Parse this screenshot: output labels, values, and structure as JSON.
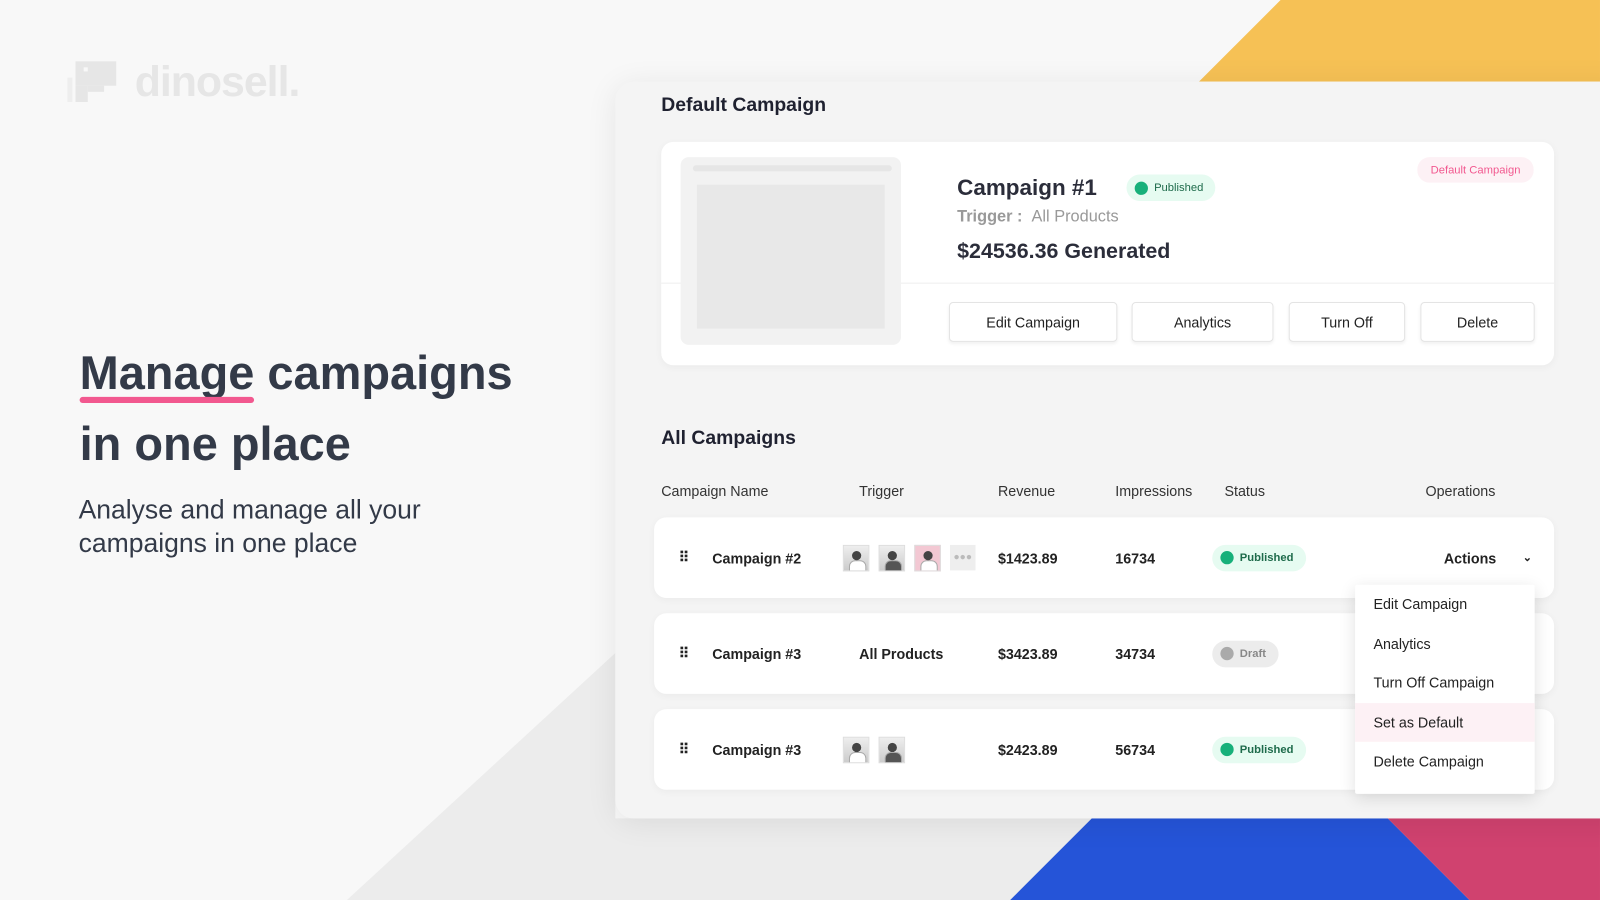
{
  "brand": {
    "name": "dinosell."
  },
  "hero": {
    "title_underlined": "Manage",
    "title_rest": " campaigns",
    "title_line2": "in one place",
    "subtitle": "Analyse and manage all your campaigns in one place"
  },
  "colors": {
    "accent_pink": "#f2588f",
    "yellow": "#f6c155",
    "blue": "#2554d8",
    "magenta": "#d0426f",
    "published_green": "#17b07a"
  },
  "default_section": {
    "title": "Default Campaign",
    "campaign": {
      "name": "Campaign #1",
      "status": "Published",
      "trigger_label": "Trigger :",
      "trigger_value": "All Products",
      "generated": "$24536.36 Generated",
      "tag": "Default Campaign"
    },
    "buttons": {
      "edit": "Edit Campaign",
      "analytics": "Analytics",
      "turn_off": "Turn Off",
      "delete": "Delete"
    }
  },
  "all_section": {
    "title": "All Campaigns",
    "columns": [
      "Campaign Name",
      "Trigger",
      "Revenue",
      "Impressions",
      "Status",
      "Operations"
    ],
    "rows": [
      {
        "name": "Campaign #2",
        "trigger": "",
        "revenue": "$1423.89",
        "impressions": "16734",
        "status": "Published",
        "actions": "Actions"
      },
      {
        "name": "Campaign #3",
        "trigger": "All Products",
        "revenue": "$3423.89",
        "impressions": "34734",
        "status": "Draft"
      },
      {
        "name": "Campaign #3",
        "trigger": "",
        "revenue": "$2423.89",
        "impressions": "56734",
        "status": "Published"
      }
    ],
    "menu": [
      "Edit Campaign",
      "Analytics",
      "Turn Off Campaign",
      "Set as Default",
      "Delete Campaign"
    ],
    "menu_highlighted": "Set as Default"
  }
}
